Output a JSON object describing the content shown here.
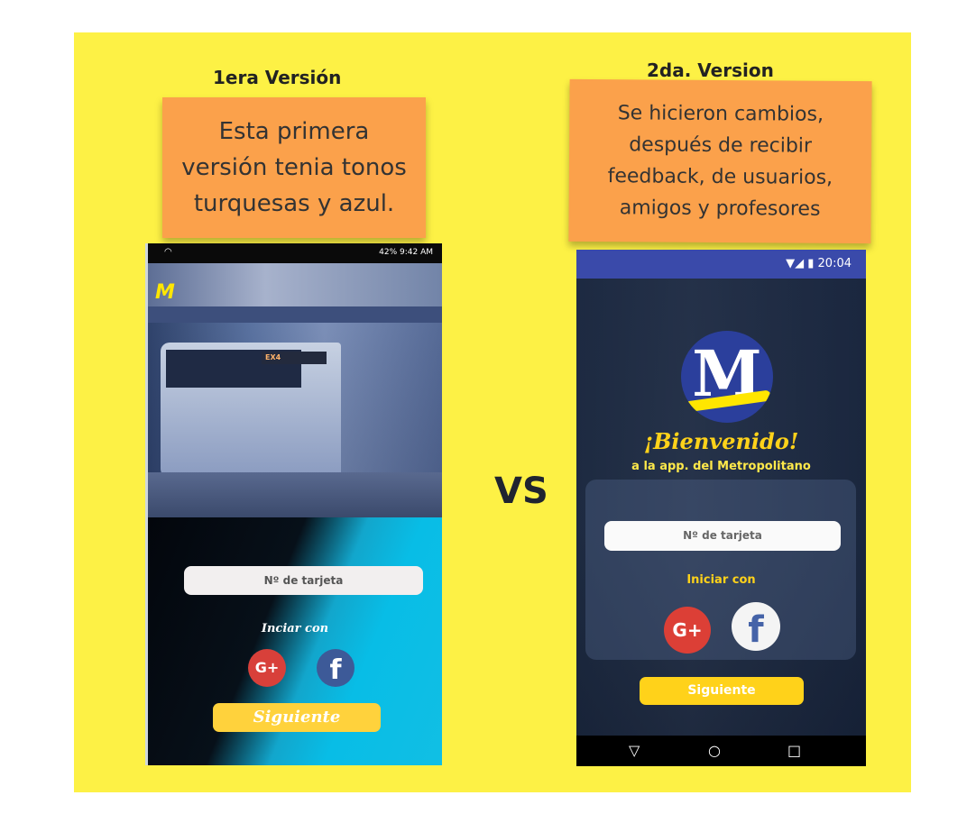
{
  "board": {
    "left_title": "1era Versión",
    "right_title": "2da. Version",
    "left_note": "Esta primera versión tenia tonos turquesas y azul.",
    "right_note": "Se hicieron cambios, después de recibir feedback, de usuarios, amigos y profesores",
    "vs": "VS"
  },
  "phone_v1": {
    "status_right": "42%  9:42 AM",
    "bus_sign": "EX4",
    "logo": "M",
    "card_placeholder": "Nº de tarjeta",
    "login_label": "Inciar con",
    "google_label": "G+",
    "facebook_label": "f",
    "next_button": "Siguiente"
  },
  "phone_v2": {
    "status_time": "20:04",
    "logo": "M",
    "welcome": "¡Bienvenido!",
    "subtitle": "a la app. del Metropolitano",
    "card_placeholder": "Nº de tarjeta",
    "login_label": "Iniciar con",
    "google_label": "G+",
    "facebook_label": "f",
    "next_button": "Siguiente",
    "nav_back": "▽",
    "nav_home": "○",
    "nav_recent": "□"
  },
  "colors": {
    "board": "#fdf145",
    "sticky": "#fba14b",
    "accent_yellow": "#ffd21a",
    "google_red": "#d8403a",
    "facebook_blue": "#3b5998"
  }
}
